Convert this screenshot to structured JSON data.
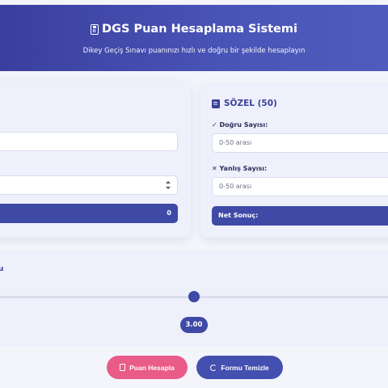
{
  "header": {
    "title": "DGS Puan Hesaplama Sistemi",
    "subtitle": "Dikey Geçiş Sınavı puanınızı hızlı ve doğru bir şekilde hesaplayın"
  },
  "left_card": {
    "result_value": "0"
  },
  "right_card": {
    "title": "SÖZEL (50)",
    "correct_label": "✓ Doğru Sayısı:",
    "correct_placeholder": "0-50 arası",
    "wrong_label": "✕ Yanlış Sayısı:",
    "wrong_placeholder": "0-50 arası",
    "net_label": "Net Sonuç:"
  },
  "slider": {
    "corner_label": "u",
    "value_display": "3.00",
    "value_fraction": 0.5
  },
  "actions": {
    "calculate_label": "Puan Hesapla",
    "clear_label": "Formu Temizle"
  },
  "colors": {
    "primary": "#3f49a6",
    "accent_pink": "#e95b88"
  }
}
